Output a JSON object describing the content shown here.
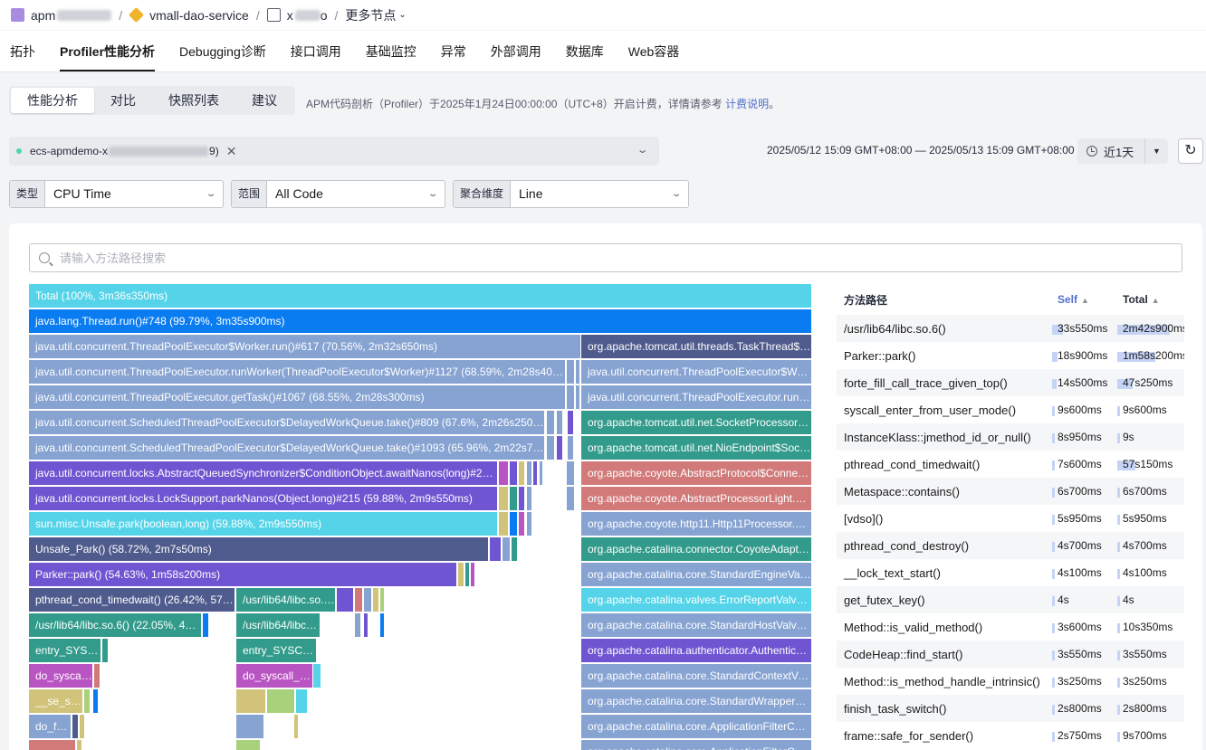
{
  "breadcrumb": {
    "app": "apm",
    "service": "vmall-dao-service",
    "instance": "x",
    "instance_suffix": "o",
    "more": "更多节点"
  },
  "tabs": [
    "拓扑",
    "Profiler性能分析",
    "Debugging诊断",
    "接口调用",
    "基础监控",
    "异常",
    "外部调用",
    "数据库",
    "Web容器"
  ],
  "subtabs": [
    "性能分析",
    "对比",
    "快照列表",
    "建议"
  ],
  "notice": {
    "text": "APM代码剖析（Profiler）于2025年1月24日00:00:00（UTC+8）开启计费，详情请参考 ",
    "link": "计费说明",
    "tail": "。"
  },
  "instance": {
    "prefix": "ecs-apmdemo-x",
    "suffix": "9)"
  },
  "time_range": "2025/05/12 15:09 GMT+08:00 — 2025/05/13 15:09 GMT+08:00",
  "quick_range": "近1天",
  "filters": {
    "type_label": "类型",
    "type_value": "CPU Time",
    "scope_label": "范围",
    "scope_value": "All Code",
    "agg_label": "聚合维度",
    "agg_value": "Line"
  },
  "search_placeholder": "请输入方法路径搜索",
  "flame_frames": [
    {
      "label": "Total (100%, 3m36s350ms)",
      "color": "#55d4e9"
    },
    {
      "label": "java.lang.Thread.run()#748 (99.79%, 3m35s900ms)",
      "color": "#0a7cf2"
    },
    {
      "label": "java.util.concurrent.ThreadPoolExecutor$Worker.run()#617 (70.56%, 2m32s650ms)",
      "color": "#86a3d2"
    },
    {
      "label": "java.util.concurrent.ThreadPoolExecutor.runWorker(ThreadPoolExecutor$Worker)#1127 (68.59%, 2m28s400ms)",
      "color": "#86a3d2"
    },
    {
      "label": "java.util.concurrent.ThreadPoolExecutor.getTask()#1067 (68.55%, 2m28s300ms)",
      "color": "#86a3d2"
    },
    {
      "label": "java.util.concurrent.ScheduledThreadPoolExecutor$DelayedWorkQueue.take()#809 (67.6%, 2m26s250ms)",
      "color": "#86a3d2"
    },
    {
      "label": "java.util.concurrent.ScheduledThreadPoolExecutor$DelayedWorkQueue.take()#1093 (65.96%, 2m22s750ms)",
      "color": "#86a3d2"
    },
    {
      "label": "java.util.concurrent.locks.AbstractQueuedSynchronizer$ConditionObject.awaitNanos(long)#2078",
      "color": "#6f55d2"
    },
    {
      "label": "java.util.concurrent.locks.LockSupport.parkNanos(Object,long)#215 (59.88%, 2m9s550ms)",
      "color": "#6f55d2"
    },
    {
      "label": "sun.misc.Unsafe.park(boolean,long) (59.88%, 2m9s550ms)",
      "color": "#55d4e9"
    },
    {
      "label": "Unsafe_Park() (58.72%, 2m7s50ms)",
      "color": "#4f5b8c"
    },
    {
      "label": "Parker::park() (54.63%, 1m58s200ms)",
      "color": "#6f55d2"
    },
    {
      "label": "pthread_cond_timedwait() (26.42%, 57s150ms)",
      "color": "#4f5b8c"
    },
    {
      "label": "/usr/lib64/libc.so.6() (22.05%, 47s700ms)",
      "color": "#339b8c"
    },
    {
      "label": "entry_SYSCALL_64_after_hwframe()",
      "color": "#339b8c"
    },
    {
      "label": "do_syscall_64()",
      "color": "#b955c3"
    },
    {
      "label": "__se_sys_futex()",
      "color": "#d2c37a"
    },
    {
      "label": "do_futex()",
      "color": "#86a3d2"
    },
    {
      "label": "futex_wait()",
      "color": "#d27a7a"
    },
    {
      "label": "/usr/lib64/libc.so.6()",
      "color": "#339b8c"
    },
    {
      "label": "/usr/lib64/libc.so.6()",
      "color": "#339b8c"
    },
    {
      "label": "entry_SYSCALL_64_after_hwframe()",
      "color": "#339b8c"
    },
    {
      "label": "do_syscall_64()",
      "color": "#b955c3"
    },
    {
      "label": "org.apache.tomcat.util.threads.TaskThread$WrappingRunnable.run()",
      "color": "#4f5b8c"
    },
    {
      "label": "java.util.concurrent.ThreadPoolExecutor$Worker.run()",
      "color": "#86a3d2"
    },
    {
      "label": "java.util.concurrent.ThreadPoolExecutor.runWorker()",
      "color": "#86a3d2"
    },
    {
      "label": "org.apache.tomcat.util.net.SocketProcessorBase.run()",
      "color": "#339b8c"
    },
    {
      "label": "org.apache.tomcat.util.net.NioEndpoint$SocketProcessor.doRun()",
      "color": "#339b8c"
    },
    {
      "label": "org.apache.coyote.AbstractProtocol$ConnectionHandler.process()",
      "color": "#d27a7a"
    },
    {
      "label": "org.apache.coyote.AbstractProcessorLight.process()",
      "color": "#d27a7a"
    },
    {
      "label": "org.apache.coyote.http11.Http11Processor.service()",
      "color": "#86a3d2"
    },
    {
      "label": "org.apache.catalina.connector.CoyoteAdapter.service()",
      "color": "#339b8c"
    },
    {
      "label": "org.apache.catalina.core.StandardEngineValve.invoke()",
      "color": "#86a3d2"
    },
    {
      "label": "org.apache.catalina.valves.ErrorReportValve.invoke()",
      "color": "#55d4e9"
    },
    {
      "label": "org.apache.catalina.core.StandardHostValve.invoke()",
      "color": "#86a3d2"
    },
    {
      "label": "org.apache.catalina.authenticator.AuthenticatorBase.invoke()",
      "color": "#6f55d2"
    },
    {
      "label": "org.apache.catalina.core.StandardContextValve.invoke()",
      "color": "#86a3d2"
    },
    {
      "label": "org.apache.catalina.core.StandardWrapperValve.invoke()",
      "color": "#86a3d2"
    },
    {
      "label": "org.apache.catalina.core.ApplicationFilterChain.doFilter()",
      "color": "#86a3d2"
    },
    {
      "label": "org.apache.catalina.core.ApplicationFilterChain.internalDoFilter()",
      "color": "#86a3d2"
    }
  ],
  "method_table": {
    "headers": {
      "path": "方法路径",
      "self": "Self",
      "total": "Total"
    },
    "rows": [
      {
        "path": "/usr/lib64/libc.so.6()",
        "self": "33s550ms",
        "total": "2m42s900ms",
        "self_frac": 0.16,
        "total_frac": 0.78
      },
      {
        "path": "Parker::park()",
        "self": "18s900ms",
        "total": "1m58s200ms",
        "self_frac": 0.09,
        "total_frac": 0.57
      },
      {
        "path": "forte_fill_call_trace_given_top()",
        "self": "14s500ms",
        "total": "47s250ms",
        "self_frac": 0.07,
        "total_frac": 0.23
      },
      {
        "path": "syscall_enter_from_user_mode()",
        "self": "9s600ms",
        "total": "9s600ms",
        "self_frac": 0.0,
        "total_frac": 0.0
      },
      {
        "path": "InstanceKlass::jmethod_id_or_null()",
        "self": "8s950ms",
        "total": "9s",
        "self_frac": 0.0,
        "total_frac": 0.0
      },
      {
        "path": "pthread_cond_timedwait()",
        "self": "7s600ms",
        "total": "57s150ms",
        "self_frac": 0.0,
        "total_frac": 0.27
      },
      {
        "path": "Metaspace::contains()",
        "self": "6s700ms",
        "total": "6s700ms",
        "self_frac": 0.0,
        "total_frac": 0.0
      },
      {
        "path": "[vdso]()",
        "self": "5s950ms",
        "total": "5s950ms",
        "self_frac": 0.0,
        "total_frac": 0.0
      },
      {
        "path": "pthread_cond_destroy()",
        "self": "4s700ms",
        "total": "4s700ms",
        "self_frac": 0.0,
        "total_frac": 0.0
      },
      {
        "path": "__lock_text_start()",
        "self": "4s100ms",
        "total": "4s100ms",
        "self_frac": 0.0,
        "total_frac": 0.0
      },
      {
        "path": "get_futex_key()",
        "self": "4s",
        "total": "4s",
        "self_frac": 0.0,
        "total_frac": 0.0
      },
      {
        "path": "Method::is_valid_method()",
        "self": "3s600ms",
        "total": "10s350ms",
        "self_frac": 0.0,
        "total_frac": 0.0
      },
      {
        "path": "CodeHeap::find_start()",
        "self": "3s550ms",
        "total": "3s550ms",
        "self_frac": 0.0,
        "total_frac": 0.0
      },
      {
        "path": "Method::is_method_handle_intrinsic()",
        "self": "3s250ms",
        "total": "3s250ms",
        "self_frac": 0.0,
        "total_frac": 0.0
      },
      {
        "path": "finish_task_switch()",
        "self": "2s800ms",
        "total": "2s800ms",
        "self_frac": 0.0,
        "total_frac": 0.0
      },
      {
        "path": "frame::safe_for_sender()",
        "self": "2s750ms",
        "total": "9s700ms",
        "self_frac": 0.0,
        "total_frac": 0.0
      }
    ]
  }
}
